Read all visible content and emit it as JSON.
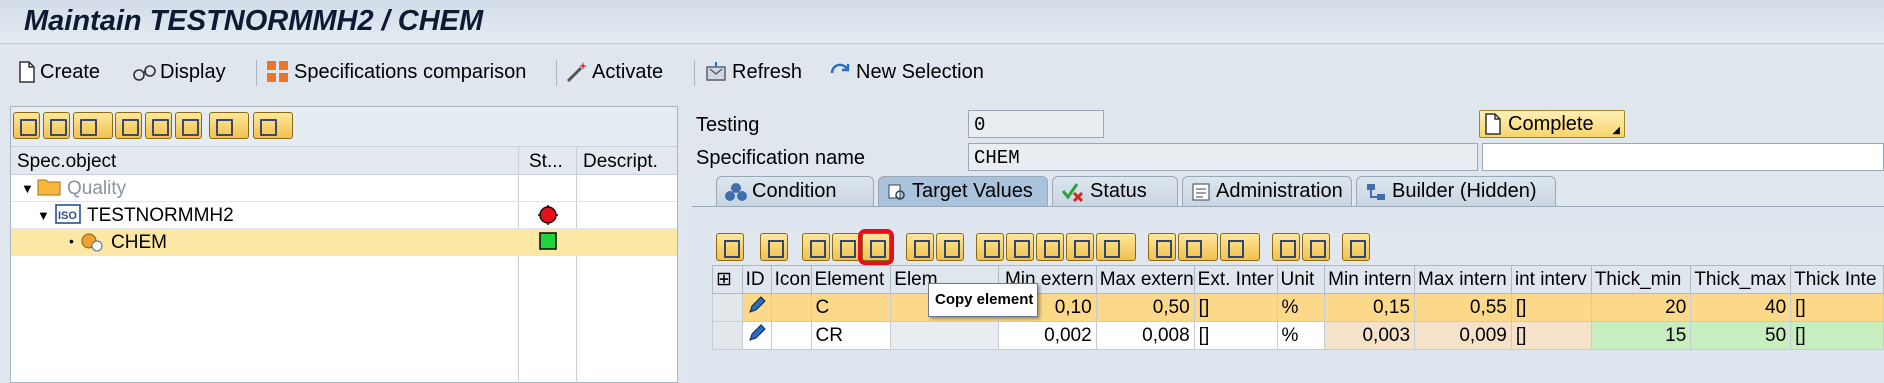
{
  "title": "Maintain TESTNORMMH2 / CHEM",
  "toolbar": {
    "create": "Create",
    "display": "Display",
    "spec_comparison": "Specifications comparison",
    "activate": "Activate",
    "refresh": "Refresh",
    "new_selection": "New Selection"
  },
  "tree": {
    "headers": {
      "spec_object": "Spec.object",
      "status": "St...",
      "description": "Descript."
    },
    "nodes": [
      {
        "label": "Quality",
        "icon": "folder-icon"
      },
      {
        "label": "TESTNORMMH2",
        "icon": "iso-icon",
        "status_icon": "status-red-icon"
      },
      {
        "label": "CHEM",
        "icon": "chem-icon",
        "status_icon": "status-green-icon"
      }
    ]
  },
  "header_fields": {
    "testing_label": "Testing",
    "testing_value": "0",
    "spec_name_label": "Specification name",
    "spec_name_value": "CHEM",
    "complete_button": "Complete"
  },
  "tabs": [
    {
      "label": "Condition",
      "icon": "condition-icon"
    },
    {
      "label": "Target Values",
      "icon": "target-values-icon",
      "active": true
    },
    {
      "label": "Status",
      "icon": "status-icon"
    },
    {
      "label": "Administration",
      "icon": "administration-icon"
    },
    {
      "label": "Builder (Hidden)",
      "icon": "builder-icon"
    }
  ],
  "grid": {
    "columns": [
      "ID",
      "Icon",
      "Element",
      "Elem",
      "Min extern",
      "Max extern",
      "Ext. Inter",
      "Unit",
      "Min intern",
      "Max intern",
      "int interv",
      "Thick_min",
      "Thick_max",
      "Thick Inte"
    ],
    "rows": [
      {
        "element": "C",
        "min_ext": "0,10",
        "max_ext": "0,50",
        "ext_int": "[]",
        "unit": "%",
        "min_int": "0,15",
        "max_int": "0,55",
        "int_int": "[]",
        "thick_min": "20",
        "thick_max": "40",
        "thick_int": "[]"
      },
      {
        "element": "CR",
        "min_ext": "0,002",
        "max_ext": "0,008",
        "ext_int": "[]",
        "unit": "%",
        "min_int": "0,003",
        "max_int": "0,009",
        "int_int": "[]",
        "thick_min": "15",
        "thick_max": "50",
        "thick_int": "[]"
      }
    ]
  },
  "tooltip": "Copy element",
  "colors": {
    "highlight": "#e5101c",
    "selected_row": "#fcd98a",
    "thick_bg": "#c8eec0"
  }
}
